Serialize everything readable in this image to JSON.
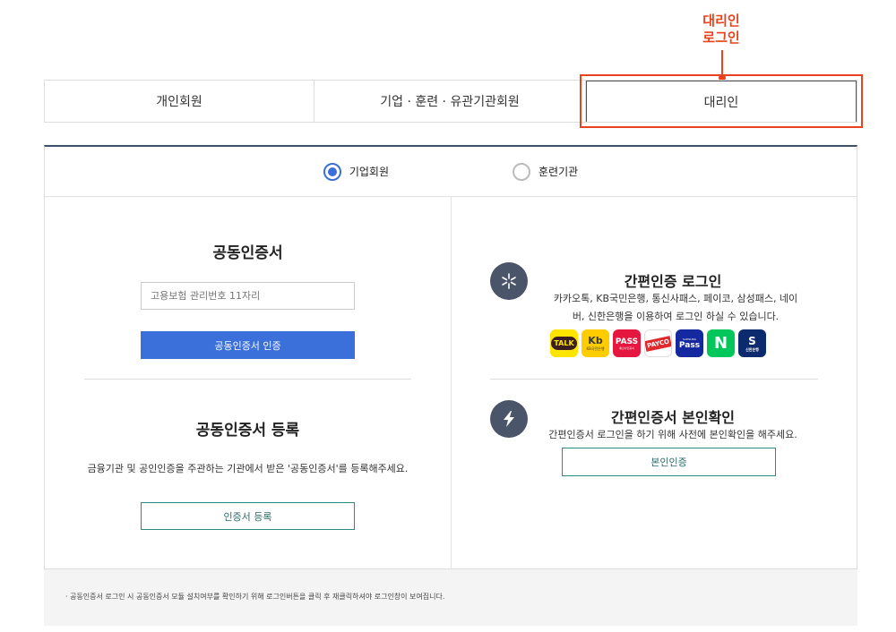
{
  "annotation": {
    "line1": "대리인",
    "line2": "로그인"
  },
  "tabs": [
    {
      "label": "개인회원"
    },
    {
      "label": "기업 · 훈련 · 유관기관회원"
    },
    {
      "label": "대리인"
    }
  ],
  "member_type": {
    "options": [
      {
        "label": "기업회원",
        "selected": true
      },
      {
        "label": "훈련기관",
        "selected": false
      }
    ]
  },
  "left": {
    "cert_title": "공동인증서",
    "input_placeholder": "고용보험 관리번호 11자리",
    "cert_button": "공동인증서 인증",
    "register_title": "공동인증서 등록",
    "register_desc": "금융기관 및 공인인증을 주관하는 기관에서 받은 '공동인증서'를 등록해주세요.",
    "register_button": "인증서 등록"
  },
  "right": {
    "simple_title": "간편인증 로그인",
    "simple_desc_line1": "카카오톡, KB국민은행, 통신사패스, 페이코, 삼성패스, 네이",
    "simple_desc_line2": "버, 신한은행을 이용하여 로그인 하실 수 있습니다.",
    "providers": [
      {
        "name": "카카오톡",
        "icon": "kakaotalk-icon",
        "text": "TALK",
        "color": "#fee500"
      },
      {
        "name": "KB국민은행",
        "icon": "kb-bank-icon",
        "text": "Kb",
        "sub": "KB국민은행",
        "color": "#ffcc00"
      },
      {
        "name": "통신사패스",
        "icon": "pass-icon",
        "text": "PASS",
        "sub": "통신사인증서",
        "color": "#e5173f"
      },
      {
        "name": "페이코",
        "icon": "payco-icon",
        "text": "PAYCO",
        "color": "#e0282d"
      },
      {
        "name": "삼성패스",
        "icon": "samsung-pass-icon",
        "text": "Pass",
        "sub": "SAMSUNG",
        "color": "#1428a0"
      },
      {
        "name": "네이버",
        "icon": "naver-icon",
        "text": "N",
        "color": "#03c75a"
      },
      {
        "name": "신한은행",
        "icon": "shinhan-bank-icon",
        "text": "S",
        "sub": "신한은행",
        "color": "#0c2a6e"
      }
    ],
    "verify_title": "간편인증서 본인확인",
    "verify_desc": "간편인증서 로그인을 하기 위해 사전에 본인확인을 해주세요.",
    "verify_button": "본인인증"
  },
  "footer": {
    "note": "· 공동인증서 로그인 시 공동인증서 모듈 설치여부를 확인하기 위해 로그인버튼을 클릭 후 재클릭하셔야 로그인창이 보여집니다."
  },
  "colors": {
    "accent": "#3b6fd9",
    "annotation": "#e8431e",
    "outline": "#2a8a86",
    "icon_bg": "#4b5569"
  }
}
